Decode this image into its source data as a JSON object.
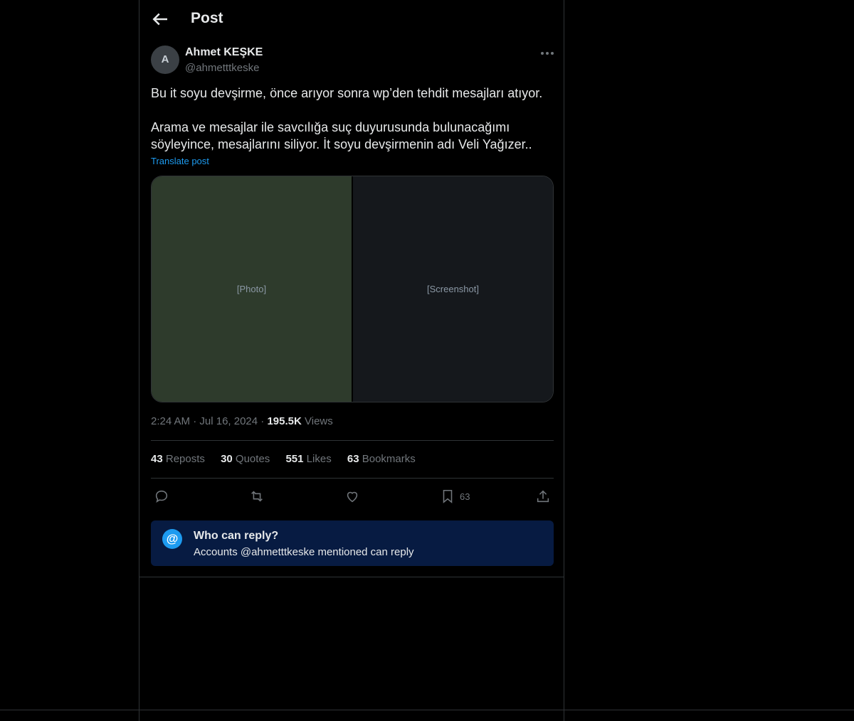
{
  "header": {
    "title": "Post"
  },
  "author": {
    "name": "Ahmet KEŞKE",
    "handle": "@ahmetttkeske",
    "avatar_icon": "avatar-icon"
  },
  "post": {
    "line1": "Bu it soyu devşirme, önce arıyor sonra wp’den tehdit mesajları atıyor.",
    "line2": "Arama ve mesajlar ile savcılığa suç duyurusunda bulunacağımı söyleyince, mesajlarını siliyor. İt soyu devşirmenin adı Veli Yağızer..",
    "translate": "Translate post"
  },
  "media": {
    "left_label": "[Photo]",
    "right_label": "[Screenshot]"
  },
  "meta": {
    "time": "2:24 AM",
    "date": "Jul 16, 2024",
    "views": "195.5K",
    "views_label": "Views"
  },
  "stats": {
    "reposts": "43",
    "reposts_label": "Reposts",
    "quotes": "30",
    "quotes_label": "Quotes",
    "likes": "551",
    "likes_label": "Likes",
    "bookmarks": "63",
    "bookmarks_label": "Bookmarks"
  },
  "actions": {
    "bookmark_count": "63"
  },
  "reply_info": {
    "icon": "@",
    "title": "Who can reply?",
    "subtitle": "Accounts @ahmetttkeske mentioned can reply"
  },
  "colors": {
    "accent": "#1d9bf0",
    "background": "#000000",
    "muted": "#71767b",
    "reply_box": "#071b42"
  }
}
